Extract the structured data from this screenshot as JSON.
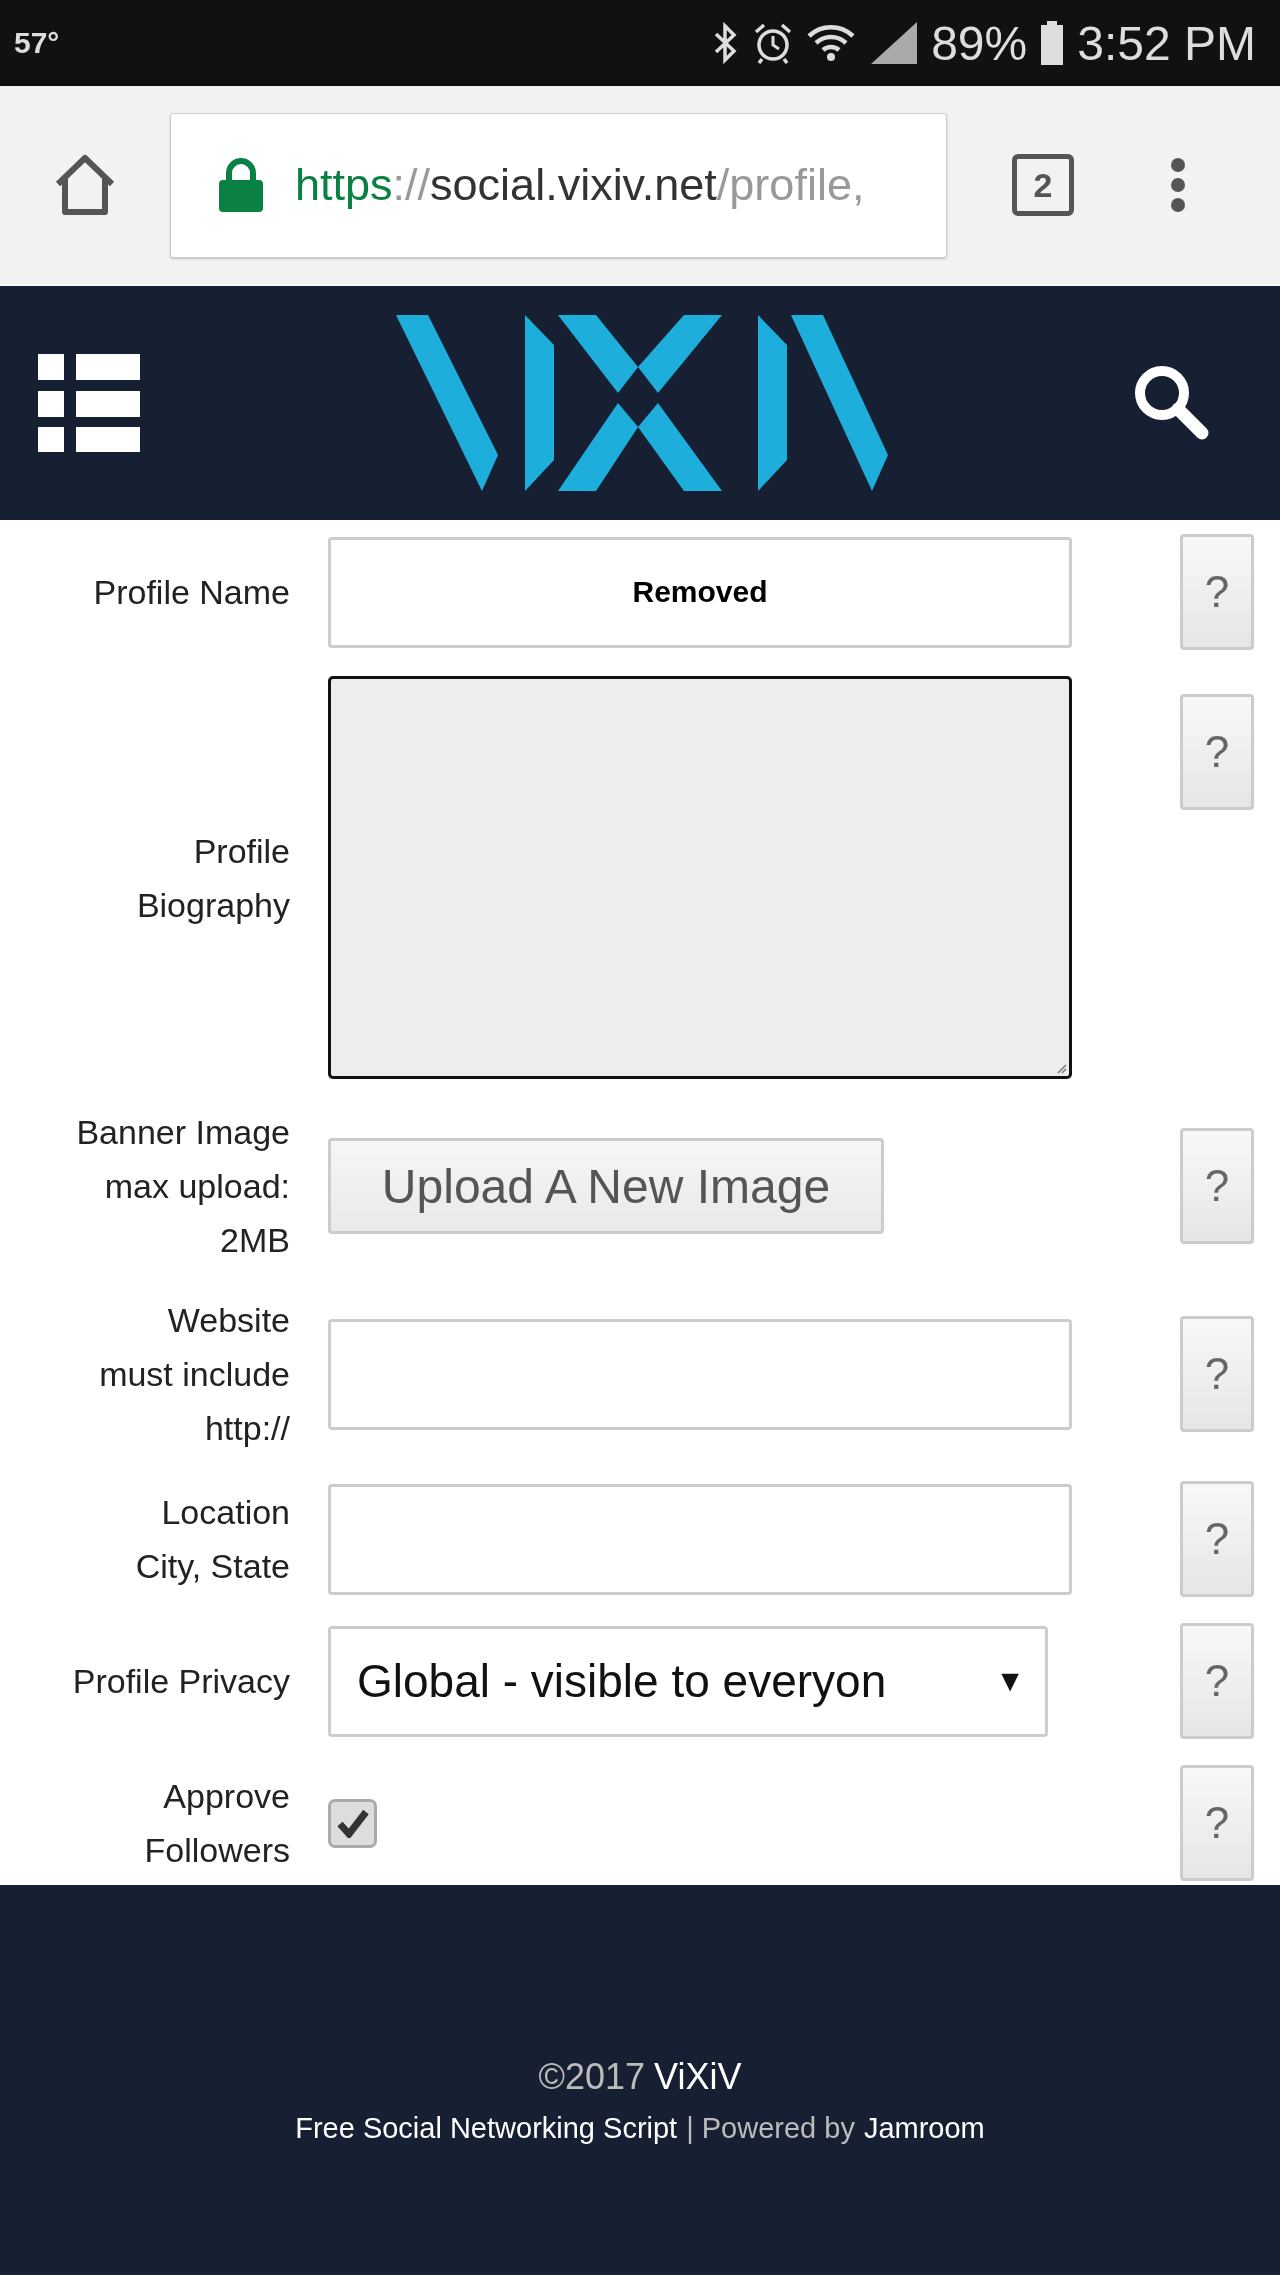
{
  "status_bar": {
    "temperature": "57°",
    "battery": "89%",
    "time": "3:52 PM"
  },
  "browser": {
    "url": {
      "scheme": "https",
      "separator": "://",
      "host": "social.vixiv.net",
      "path": "/profile,"
    },
    "secure": true,
    "tab_count": "2"
  },
  "form": {
    "rows": [
      {
        "kind": "text",
        "label": [
          "Profile Name"
        ],
        "value": "Removed",
        "help": "?"
      },
      {
        "kind": "textarea",
        "label": [
          "Profile",
          "Biography"
        ],
        "help": "?"
      },
      {
        "kind": "upload",
        "label": [
          "Banner Image",
          "max upload:",
          "2MB"
        ],
        "button": "Upload A New Image",
        "help": "?"
      },
      {
        "kind": "text",
        "label": [
          "Website",
          "must include",
          "http://"
        ],
        "help": "?"
      },
      {
        "kind": "text",
        "label": [
          "Location",
          "City, State"
        ],
        "help": "?"
      },
      {
        "kind": "select",
        "label": [
          "Profile Privacy"
        ],
        "value": "Global - visible to everyon",
        "arrow": "▼",
        "help": "?"
      },
      {
        "kind": "checkbox",
        "label": [
          "Approve",
          "Followers"
        ],
        "checked": true,
        "help": "?"
      }
    ]
  },
  "footer": {
    "copyright": "©2017",
    "site": "ViXiV",
    "script_link": "Free Social Networking Script",
    "separator": "| Powered by",
    "powered_link": "Jamroom"
  }
}
